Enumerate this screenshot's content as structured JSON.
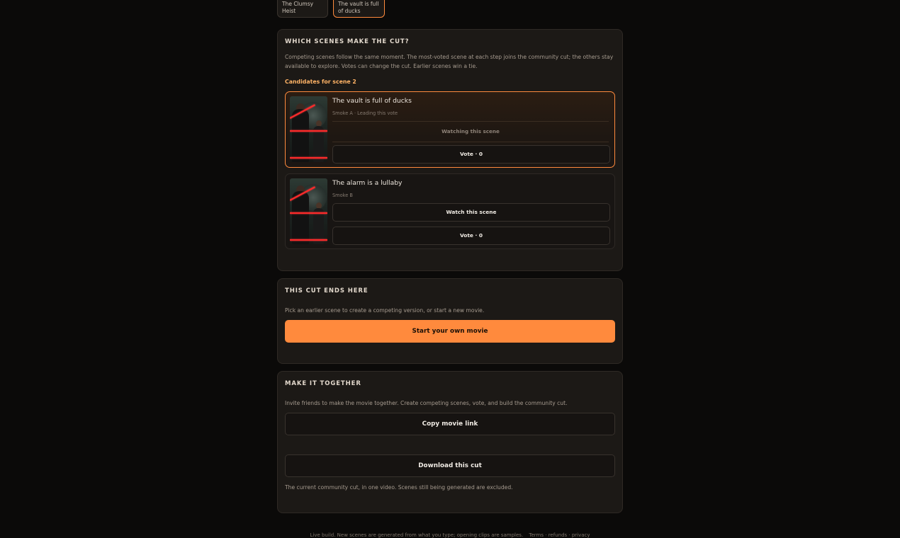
{
  "scene_tabs": [
    {
      "label": "The Clumsy Heist",
      "active": false
    },
    {
      "label": "The vault is full of ducks",
      "active": true
    }
  ],
  "scenes_panel": {
    "title": "WHICH SCENES MAKE THE CUT?",
    "description": "Competing scenes follow the same moment. The most-voted scene at each step joins the community cut; the others stay available to explore. Votes can change the cut. Earlier scenes win a tie.",
    "candidates_label": "Candidates for scene 2",
    "candidates": [
      {
        "title": "The vault is full of ducks",
        "subtitle": "Smoke A · Leading this vote",
        "status": "Watching this scene",
        "vote_label": "Vote · 0",
        "leading": true
      },
      {
        "title": "The alarm is a lullaby",
        "subtitle": "Smoke B",
        "watch_label": "Watch this scene",
        "vote_label": "Vote · 0",
        "leading": false
      }
    ]
  },
  "cut_panel": {
    "title": "THIS CUT ENDS HERE",
    "description": "Pick an earlier scene to create a competing version, or start a new movie.",
    "start_label": "Start your own movie"
  },
  "together_panel": {
    "title": "MAKE IT TOGETHER",
    "description": "Invite friends to make the movie together. Create competing scenes, vote, and build the community cut.",
    "copy_label": "Copy movie link",
    "download_label": "Download this cut",
    "download_note": "The current community cut, in one video. Scenes still being generated are excluded."
  },
  "footer": {
    "note": "Live build. New scenes are generated from what you type; opening clips are samples.",
    "links": "Terms · refunds · privacy"
  },
  "colors": {
    "accent": "#ff8a3d",
    "label_accent": "#ffb366",
    "background": "#0b0a09",
    "panel": "#1c1916"
  }
}
